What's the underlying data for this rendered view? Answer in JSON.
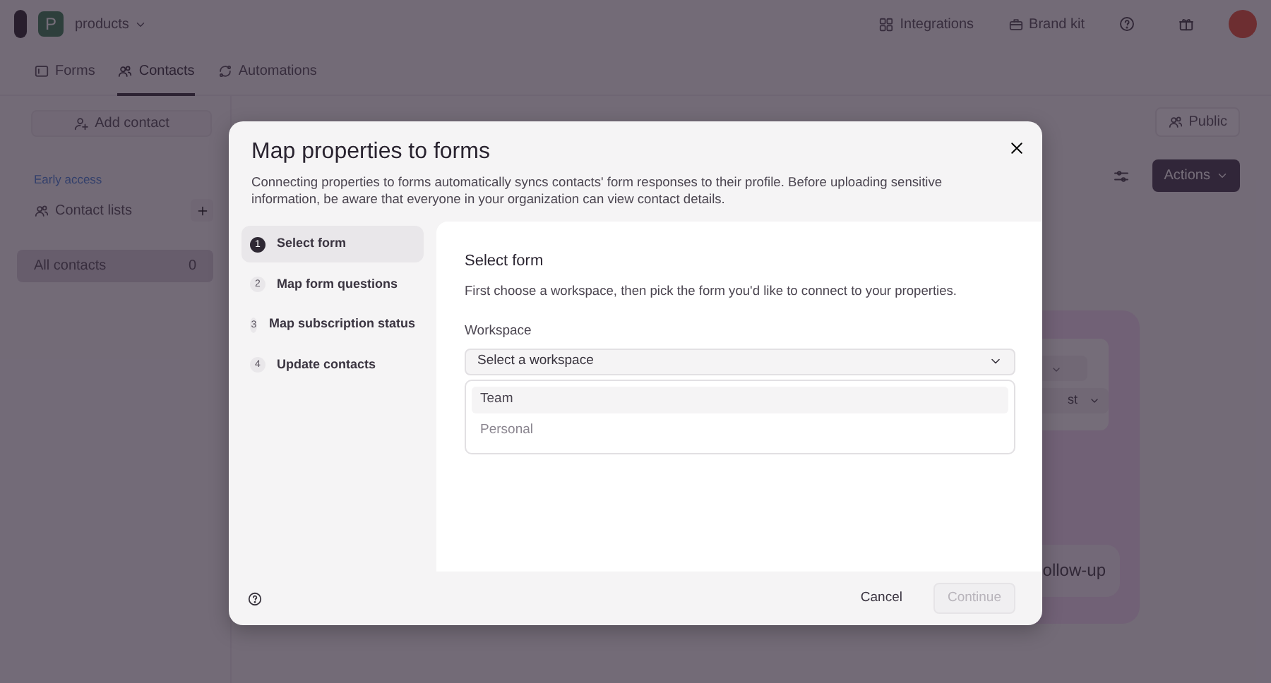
{
  "header": {
    "workspace_initial": "P",
    "workspace_name": "products",
    "links": [
      {
        "label": "Integrations",
        "kind": "integrations"
      },
      {
        "label": "Brand kit",
        "kind": "brand"
      }
    ]
  },
  "tabs": [
    {
      "label": "Forms",
      "kind": "forms",
      "selected": false
    },
    {
      "label": "Contacts",
      "kind": "contacts",
      "selected": true
    },
    {
      "label": "Automations",
      "kind": "automations",
      "selected": false
    }
  ],
  "sidebar": {
    "add_button": "Add contact",
    "section_label": "Early access",
    "lists_label": "Contact lists",
    "items": [
      {
        "label": "All contacts",
        "count": "0",
        "selected": true
      }
    ]
  },
  "toolbar": {
    "visibility": "Public",
    "actions": "Actions"
  },
  "preview": {
    "select_text": "st",
    "pill_text": "ollow-up"
  },
  "modal": {
    "title": "Map properties to forms",
    "description": "Connecting properties to forms automatically syncs contacts' form responses to their profile. Before uploading sensitive information, be aware that everyone in your organization can view contact details.",
    "steps": [
      {
        "number": "1",
        "label": "Select form",
        "selected": true
      },
      {
        "number": "2",
        "label": "Map form questions",
        "selected": false
      },
      {
        "number": "3",
        "label": "Map subscription status",
        "selected": false
      },
      {
        "number": "4",
        "label": "Update contacts",
        "selected": false
      }
    ],
    "section_title": "Select form",
    "section_description": "First choose a workspace, then pick the form you'd like to connect to your properties.",
    "field_label": "Workspace",
    "placeholder": "Select a workspace",
    "options": [
      {
        "label": "Team",
        "selected": true
      },
      {
        "label": "Personal",
        "selected": false
      }
    ],
    "cancel": "Cancel",
    "continue": {
      "label": "Continue",
      "disabled": true
    }
  }
}
